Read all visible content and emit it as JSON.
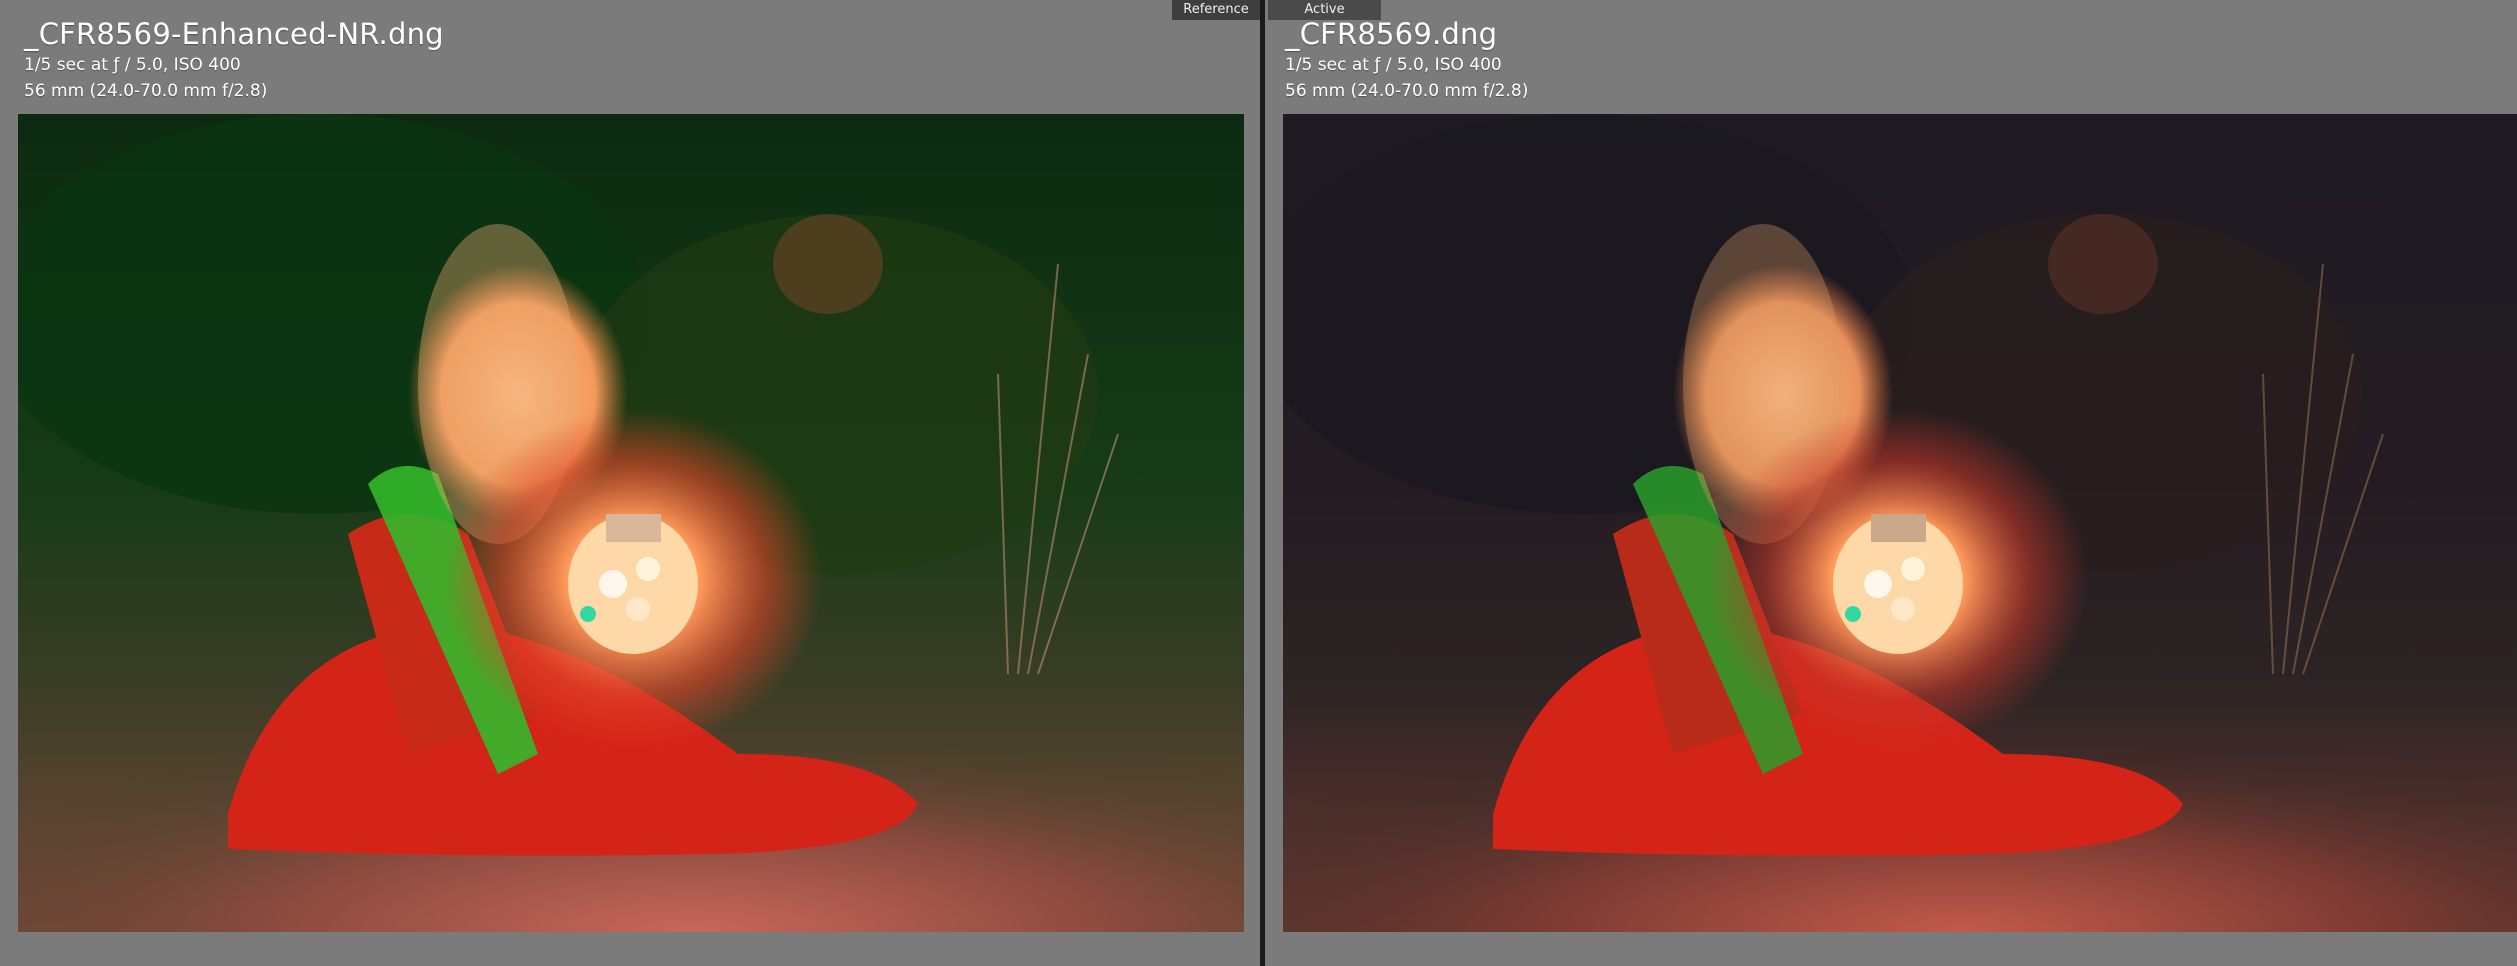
{
  "labels": {
    "reference": "Reference",
    "active": "Active"
  },
  "reference_view": {
    "filename": "_CFR8569-Enhanced-NR.dng",
    "exposure": "1/5 sec at ƒ / 5.0, ISO 400",
    "lens": "56 mm (24.0-70.0 mm f/2.8)"
  },
  "active_view": {
    "filename": "_CFR8569.dng",
    "exposure": "1/5 sec at ƒ / 5.0, ISO 400",
    "lens": "56 mm (24.0-70.0 mm f/2.8)"
  },
  "colors": {
    "background": "#7b7b7b",
    "divider": "#1a1a1a",
    "tag_bg": "#3e3e3e",
    "text": "#ffffff"
  }
}
